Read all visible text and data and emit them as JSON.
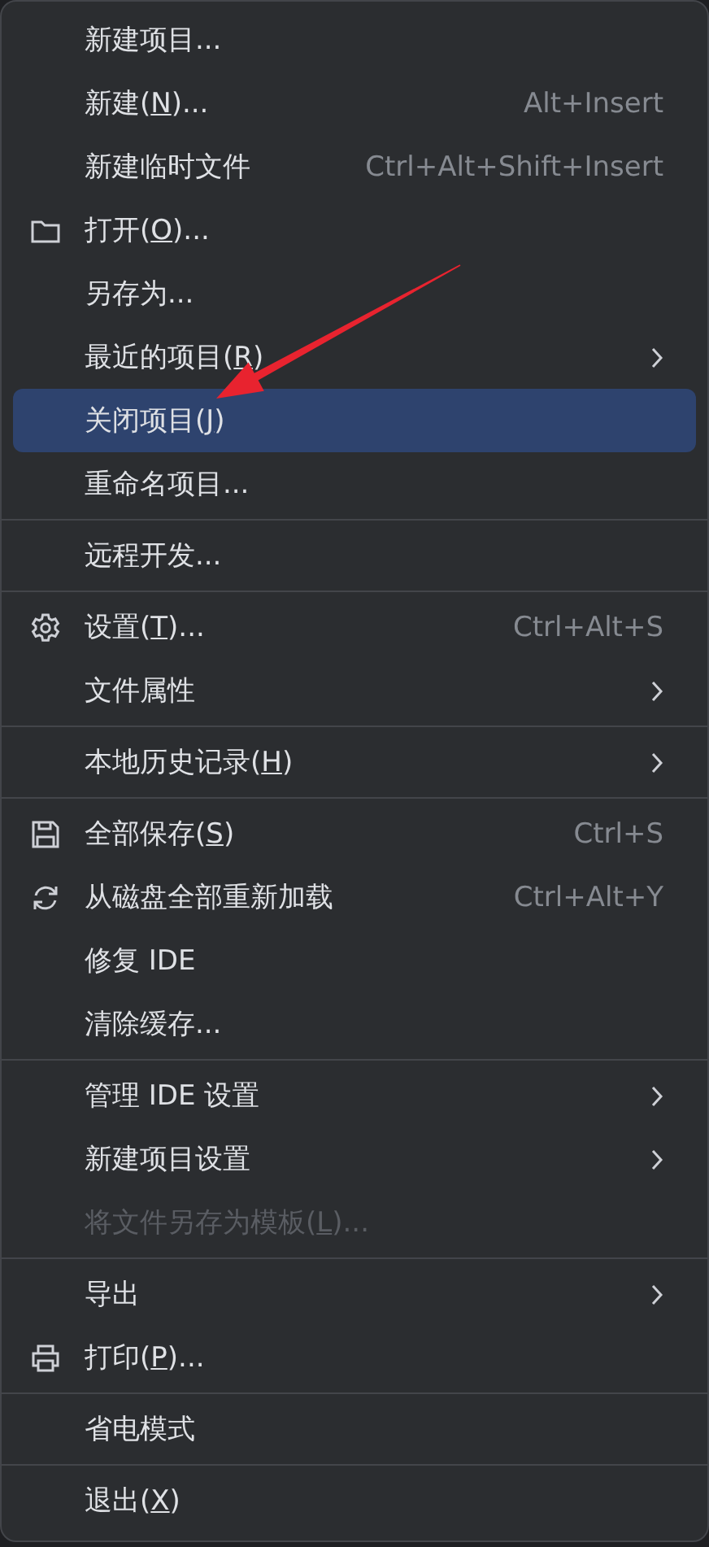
{
  "menu": {
    "groups": [
      [
        {
          "label": "新建项目...",
          "selected": false,
          "disabled": false,
          "submenu": false
        },
        {
          "label": "新建(",
          "mnemonic": "N",
          "label_rest": ")...",
          "shortcut": "Alt+Insert",
          "selected": false,
          "disabled": false,
          "submenu": false
        },
        {
          "label": "新建临时文件",
          "shortcut": "Ctrl+Alt+Shift+Insert",
          "selected": false,
          "disabled": false,
          "submenu": false
        },
        {
          "label": "打开(",
          "mnemonic": "O",
          "label_rest": ")...",
          "kind": "folder",
          "selected": false,
          "disabled": false,
          "submenu": false
        },
        {
          "label": "另存为...",
          "selected": false,
          "disabled": false,
          "submenu": false
        },
        {
          "label": "最近的项目(",
          "mnemonic": "R",
          "label_rest": ")",
          "selected": false,
          "disabled": false,
          "submenu": true
        },
        {
          "label": "关闭项目(",
          "mnemonic": "J",
          "label_rest": ")",
          "selected": true,
          "disabled": false,
          "submenu": false
        },
        {
          "label": "重命名项目...",
          "selected": false,
          "disabled": false,
          "submenu": false
        }
      ],
      [
        {
          "label": "远程开发...",
          "selected": false,
          "disabled": false,
          "submenu": false
        }
      ],
      [
        {
          "label": "设置(",
          "mnemonic": "T",
          "label_rest": ")...",
          "kind": "gear",
          "shortcut": "Ctrl+Alt+S",
          "selected": false,
          "disabled": false,
          "submenu": false
        },
        {
          "label": "文件属性",
          "selected": false,
          "disabled": false,
          "submenu": true
        }
      ],
      [
        {
          "label": "本地历史记录(",
          "mnemonic": "H",
          "label_rest": ")",
          "selected": false,
          "disabled": false,
          "submenu": true
        }
      ],
      [
        {
          "label": "全部保存(",
          "mnemonic": "S",
          "label_rest": ")",
          "kind": "floppy",
          "shortcut": "Ctrl+S",
          "selected": false,
          "disabled": false,
          "submenu": false
        },
        {
          "label": "从磁盘全部重新加载",
          "kind": "refresh",
          "shortcut": "Ctrl+Alt+Y",
          "selected": false,
          "disabled": false,
          "submenu": false
        },
        {
          "label": "修复 IDE",
          "selected": false,
          "disabled": false,
          "submenu": false
        },
        {
          "label": "清除缓存...",
          "selected": false,
          "disabled": false,
          "submenu": false
        }
      ],
      [
        {
          "label": "管理 IDE 设置",
          "selected": false,
          "disabled": false,
          "submenu": true
        },
        {
          "label": "新建项目设置",
          "selected": false,
          "disabled": false,
          "submenu": true
        },
        {
          "label": "将文件另存为模板(",
          "mnemonic": "L",
          "label_rest": ")...",
          "selected": false,
          "disabled": true,
          "submenu": false
        }
      ],
      [
        {
          "label": "导出",
          "selected": false,
          "disabled": false,
          "submenu": true
        },
        {
          "label": "打印(",
          "mnemonic": "P",
          "label_rest": ")...",
          "kind": "printer",
          "selected": false,
          "disabled": false,
          "submenu": false
        }
      ],
      [
        {
          "label": "省电模式",
          "selected": false,
          "disabled": false,
          "submenu": false
        }
      ],
      [
        {
          "label": "退出(",
          "mnemonic": "X",
          "label_rest": ")",
          "selected": false,
          "disabled": false,
          "submenu": false
        }
      ]
    ]
  }
}
